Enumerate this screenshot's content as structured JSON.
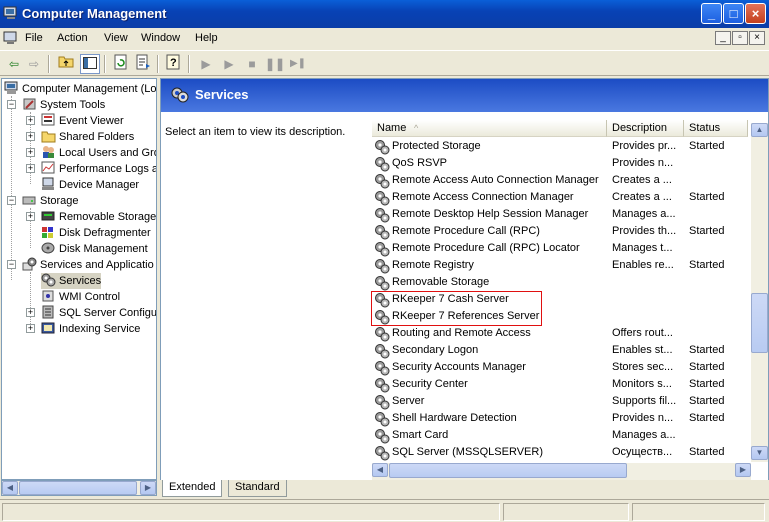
{
  "window": {
    "title": "Computer Management",
    "minimize": "_",
    "maximize": "□",
    "close": "×"
  },
  "menu": [
    "File",
    "Action",
    "View",
    "Window",
    "Help"
  ],
  "mdi_buttons": [
    "_",
    "▫",
    "×"
  ],
  "tree": {
    "root": "Computer Management (Lo",
    "items": [
      {
        "label": "System Tools",
        "icon": "tools-icon"
      },
      {
        "label": "Event Viewer",
        "icon": "event-viewer-icon"
      },
      {
        "label": "Shared Folders",
        "icon": "folder-icon"
      },
      {
        "label": "Local Users and Gro",
        "icon": "users-icon"
      },
      {
        "label": "Performance Logs a",
        "icon": "performance-icon"
      },
      {
        "label": "Device Manager",
        "icon": "device-manager-icon"
      },
      {
        "label": "Storage",
        "icon": "storage-icon"
      },
      {
        "label": "Removable Storage",
        "icon": "removable-storage-icon"
      },
      {
        "label": "Disk Defragmenter",
        "icon": "defrag-icon"
      },
      {
        "label": "Disk Management",
        "icon": "disk-management-icon"
      },
      {
        "label": "Services and Applicatio",
        "icon": "services-apps-icon"
      },
      {
        "label": "Services",
        "icon": "gear-icon"
      },
      {
        "label": "WMI Control",
        "icon": "wmi-icon"
      },
      {
        "label": "SQL Server Configu",
        "icon": "sql-server-icon"
      },
      {
        "label": "Indexing Service",
        "icon": "indexing-icon"
      }
    ]
  },
  "pane": {
    "title": "Services",
    "description": "Select an item to view its description.",
    "columns": {
      "name": "Name",
      "sort_arrow": "^",
      "description": "Description",
      "status": "Status"
    },
    "rows": [
      {
        "name": "Protected Storage",
        "description": "Provides pr...",
        "status": "Started"
      },
      {
        "name": "QoS RSVP",
        "description": "Provides n...",
        "status": ""
      },
      {
        "name": "Remote Access Auto Connection Manager",
        "description": "Creates a ...",
        "status": ""
      },
      {
        "name": "Remote Access Connection Manager",
        "description": "Creates a ...",
        "status": "Started"
      },
      {
        "name": "Remote Desktop Help Session Manager",
        "description": "Manages a...",
        "status": ""
      },
      {
        "name": "Remote Procedure Call (RPC)",
        "description": "Provides th...",
        "status": "Started"
      },
      {
        "name": "Remote Procedure Call (RPC) Locator",
        "description": "Manages t...",
        "status": ""
      },
      {
        "name": "Remote Registry",
        "description": "Enables re...",
        "status": "Started"
      },
      {
        "name": "Removable Storage",
        "description": "",
        "status": ""
      },
      {
        "name": "RKeeper 7 Cash Server",
        "description": "",
        "status": ""
      },
      {
        "name": "RKeeper 7 References Server",
        "description": "",
        "status": ""
      },
      {
        "name": "Routing and Remote Access",
        "description": "Offers rout...",
        "status": ""
      },
      {
        "name": "Secondary Logon",
        "description": "Enables st...",
        "status": "Started"
      },
      {
        "name": "Security Accounts Manager",
        "description": "Stores sec...",
        "status": "Started"
      },
      {
        "name": "Security Center",
        "description": "Monitors s...",
        "status": "Started"
      },
      {
        "name": "Server",
        "description": "Supports fil...",
        "status": "Started"
      },
      {
        "name": "Shell Hardware Detection",
        "description": "Provides n...",
        "status": "Started"
      },
      {
        "name": "Smart Card",
        "description": "Manages a...",
        "status": ""
      },
      {
        "name": "SQL Server (MSSQLSERVER)",
        "description": "Осуществ...",
        "status": "Started"
      }
    ]
  },
  "tabs": [
    "Extended",
    "Standard"
  ]
}
